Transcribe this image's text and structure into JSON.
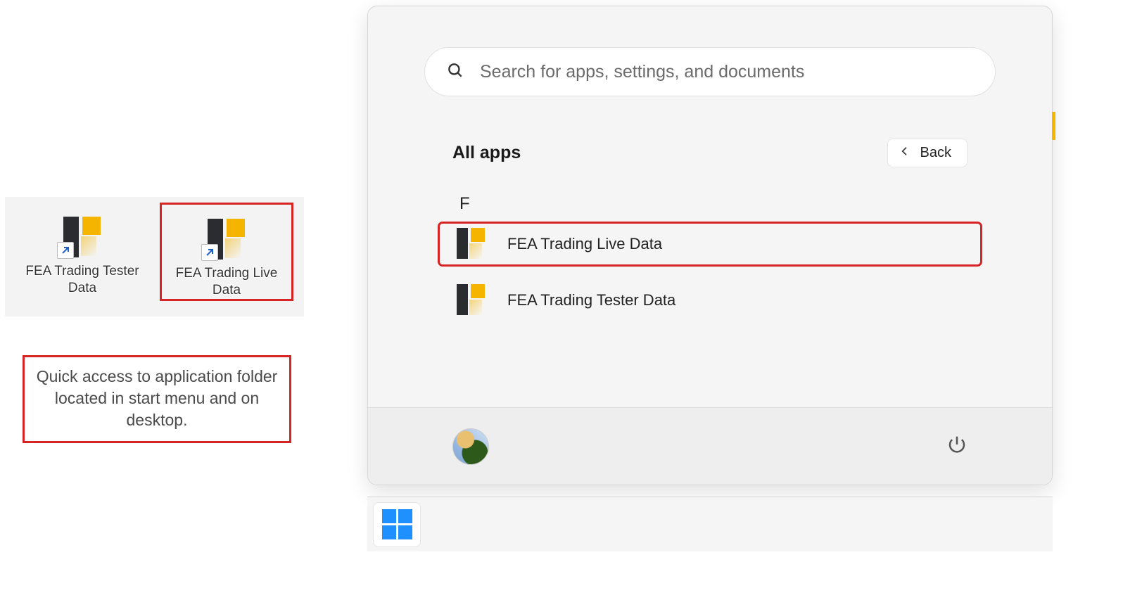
{
  "desktop": {
    "shortcuts": [
      {
        "label": "FEA Trading Tester Data",
        "highlighted": false
      },
      {
        "label": "FEA Trading Live Data",
        "highlighted": true
      }
    ]
  },
  "caption": "Quick access to application folder located in start menu and on desktop.",
  "start_menu": {
    "search_placeholder": "Search for apps, settings, and documents",
    "header": "All apps",
    "back_label": "Back",
    "alpha_group": "F",
    "apps": [
      {
        "label": "FEA Trading Live Data",
        "highlighted": true
      },
      {
        "label": "FEA Trading Tester Data",
        "highlighted": false
      }
    ]
  }
}
